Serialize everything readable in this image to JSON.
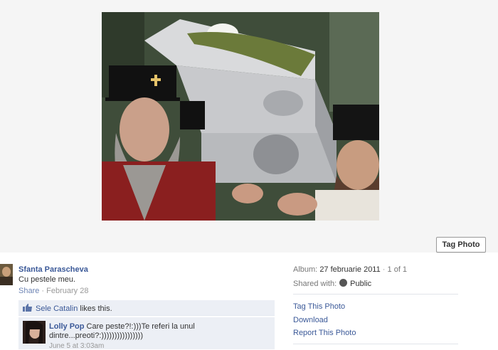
{
  "photo": {
    "alt": "Orthodox clergy carrying an ornate silver reliquary",
    "tag_button_label": "Tag Photo"
  },
  "post": {
    "owner_name": "Sfanta Parascheva",
    "caption": "Cu pestele meu.",
    "share_label": "Share",
    "separator": " · ",
    "date": "February 28"
  },
  "likes": {
    "liker": "Sele Catalin",
    "text": " likes this."
  },
  "comments": [
    {
      "author": "Lolly Pop",
      "text": " Care peste?!:)))Te referi la unul dintre...preoti?:))))))))))))))))",
      "time": "June 5 at 3:03am"
    }
  ],
  "details": {
    "album_label": "Album:",
    "album_name": "27 februarie 2011",
    "position": "1 of 1",
    "shared_label": "Shared with:",
    "privacy": "Public"
  },
  "actions": {
    "tag": "Tag This Photo",
    "download": "Download",
    "report": "Report This Photo"
  },
  "colors": {
    "link": "#3b5998",
    "panel": "#eceff5",
    "stage": "#f5f5f5"
  }
}
